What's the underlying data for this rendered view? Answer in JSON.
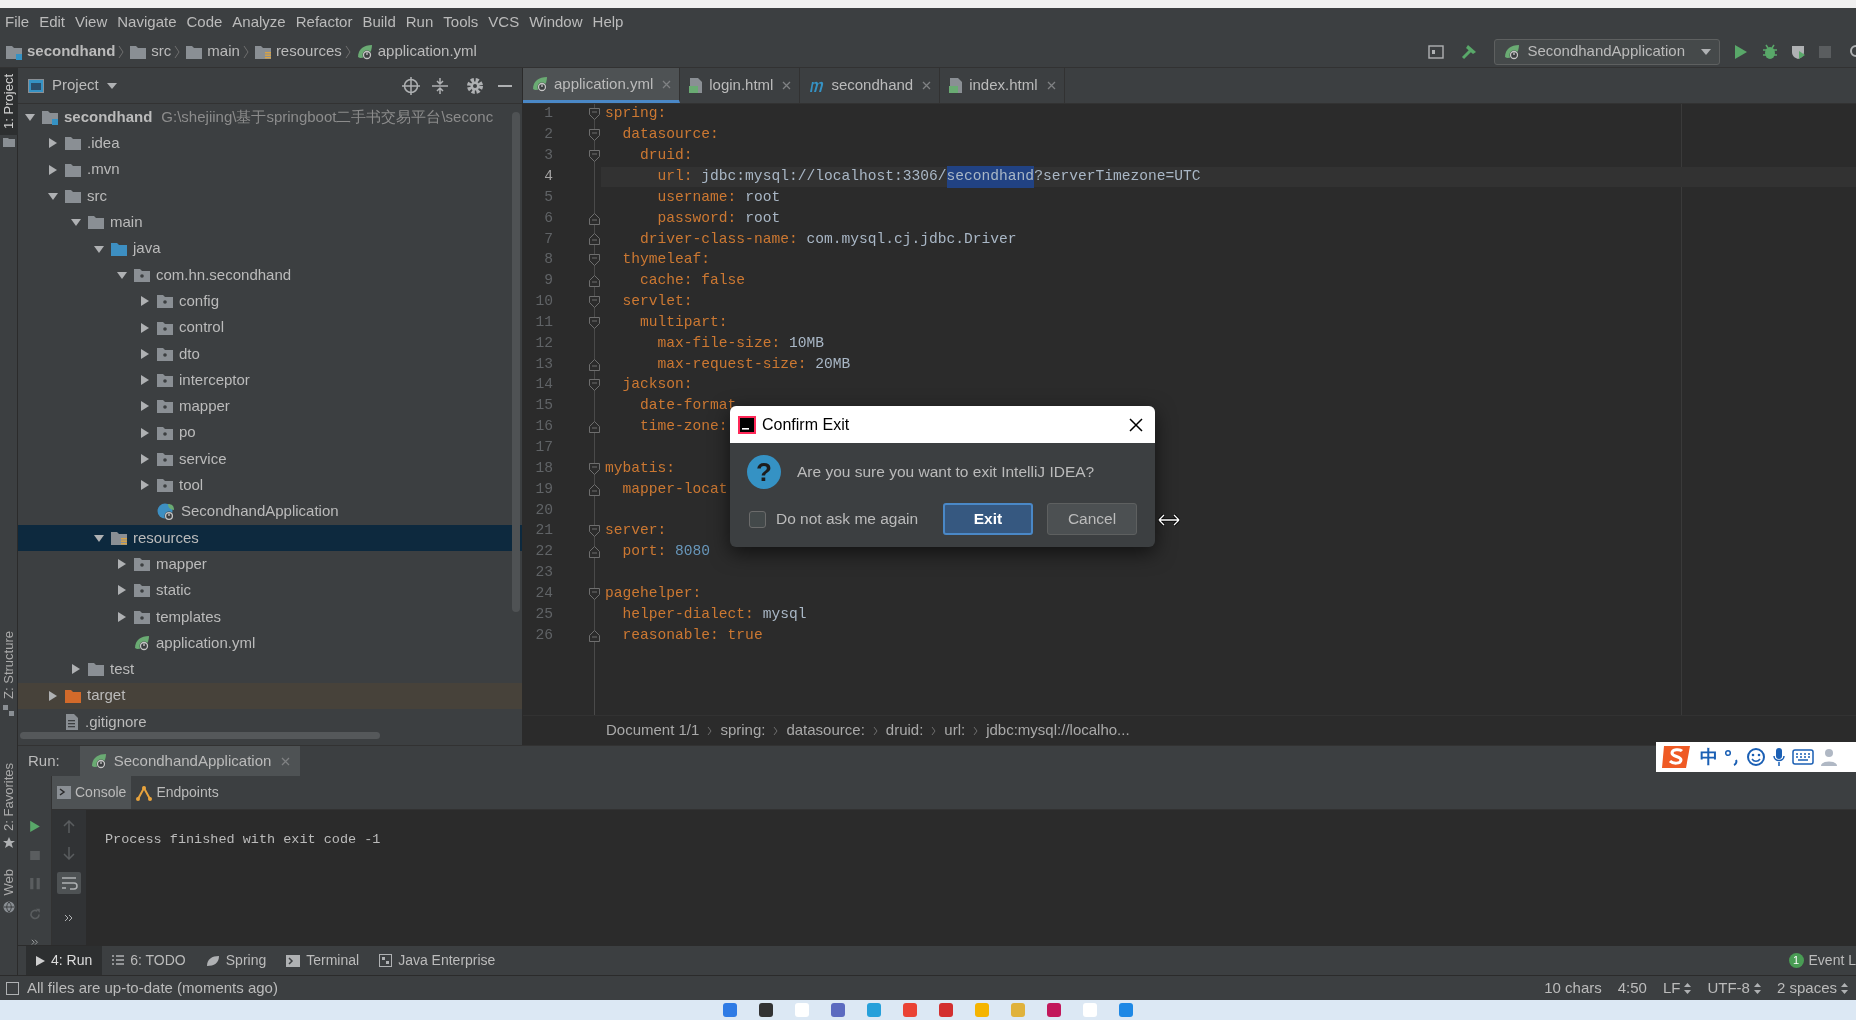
{
  "menu": [
    "File",
    "Edit",
    "View",
    "Navigate",
    "Code",
    "Analyze",
    "Refactor",
    "Build",
    "Run",
    "Tools",
    "VCS",
    "Window",
    "Help"
  ],
  "nav": {
    "crumbs": [
      {
        "label": "secondhand",
        "kind": "module"
      },
      {
        "label": "src",
        "kind": "folder"
      },
      {
        "label": "main",
        "kind": "folder"
      },
      {
        "label": "resources",
        "kind": "resources"
      },
      {
        "label": "application.yml",
        "kind": "yml"
      }
    ],
    "run_config": "SecondhandApplication"
  },
  "side_strip": {
    "top": [
      {
        "label": "1: Project",
        "selected": true
      }
    ],
    "middle": [
      {
        "label": "Z: Structure",
        "selected": false
      }
    ],
    "bottom": [
      {
        "label": "2: Favorites",
        "selected": false
      },
      {
        "label": "Web",
        "selected": false
      }
    ]
  },
  "project": {
    "title": "Project",
    "tree": [
      {
        "label": "secondhand",
        "path": "G:\\shejiing\\基于springboot二手书交易平台\\seconc",
        "kind": "module",
        "expanded": true,
        "selected": false,
        "children": [
          {
            "label": ".idea",
            "kind": "folder",
            "expanded": false,
            "selected": false
          },
          {
            "label": ".mvn",
            "kind": "folder",
            "expanded": false,
            "selected": false
          },
          {
            "label": "src",
            "kind": "folder",
            "expanded": true,
            "selected": false,
            "children": [
              {
                "label": "main",
                "kind": "folder",
                "expanded": true,
                "selected": false,
                "children": [
                  {
                    "label": "java",
                    "kind": "source",
                    "expanded": true,
                    "selected": false,
                    "children": [
                      {
                        "label": "com.hn.secondhand",
                        "kind": "package",
                        "expanded": true,
                        "selected": false,
                        "children": [
                          {
                            "label": "config",
                            "kind": "package",
                            "expanded": false,
                            "selected": false
                          },
                          {
                            "label": "control",
                            "kind": "package",
                            "expanded": false,
                            "selected": false
                          },
                          {
                            "label": "dto",
                            "kind": "package",
                            "expanded": false,
                            "selected": false
                          },
                          {
                            "label": "interceptor",
                            "kind": "package",
                            "expanded": false,
                            "selected": false
                          },
                          {
                            "label": "mapper",
                            "kind": "package",
                            "expanded": false,
                            "selected": false
                          },
                          {
                            "label": "po",
                            "kind": "package",
                            "expanded": false,
                            "selected": false
                          },
                          {
                            "label": "service",
                            "kind": "package",
                            "expanded": false,
                            "selected": false
                          },
                          {
                            "label": "tool",
                            "kind": "package",
                            "expanded": false,
                            "selected": false
                          },
                          {
                            "label": "SecondhandApplication",
                            "kind": "spring-class",
                            "selected": false
                          }
                        ]
                      }
                    ]
                  },
                  {
                    "label": "resources",
                    "kind": "resources",
                    "expanded": true,
                    "selected": true,
                    "children": [
                      {
                        "label": "mapper",
                        "kind": "package",
                        "expanded": false,
                        "selected": false
                      },
                      {
                        "label": "static",
                        "kind": "package",
                        "expanded": false,
                        "selected": false
                      },
                      {
                        "label": "templates",
                        "kind": "package",
                        "expanded": false,
                        "selected": false
                      },
                      {
                        "label": "application.yml",
                        "kind": "yml",
                        "selected": false
                      }
                    ]
                  }
                ]
              },
              {
                "label": "test",
                "kind": "folder",
                "expanded": false,
                "selected": false
              }
            ]
          },
          {
            "label": "target",
            "kind": "excluded",
            "expanded": false,
            "selected": false
          },
          {
            "label": ".gitignore",
            "kind": "file",
            "selected": false
          }
        ]
      }
    ]
  },
  "editor": {
    "tabs": [
      {
        "label": "application.yml",
        "kind": "yml",
        "selected": true
      },
      {
        "label": "login.html",
        "kind": "html",
        "selected": false
      },
      {
        "label": "secondhand",
        "kind": "maven",
        "selected": false
      },
      {
        "label": "index.html",
        "kind": "html",
        "selected": false
      }
    ],
    "lines": [
      {
        "n": "1",
        "key": "spring:",
        "fold_start": true,
        "children": [
          {
            "n": "2",
            "key": "datasource:",
            "fold_start": true,
            "children": [
              {
                "n": "3",
                "key": "druid:",
                "fold_start": true,
                "children": [
                  {
                    "n": "4",
                    "key": "url:",
                    "current": true,
                    "parts": [
                      {
                        "text": "jdbc:mysql://localhost:3306/",
                        "kind": "plain",
                        "selected": false
                      },
                      {
                        "text": "secondhand",
                        "kind": "plain",
                        "selected": true
                      },
                      {
                        "text": "?serverTimezone=UTC",
                        "kind": "plain",
                        "selected": false
                      }
                    ]
                  },
                  {
                    "n": "5",
                    "key": "username:",
                    "parts": [
                      {
                        "text": "root",
                        "kind": "plain"
                      }
                    ]
                  },
                  {
                    "n": "6",
                    "key": "password:",
                    "fold_end": true,
                    "parts": [
                      {
                        "text": "root",
                        "kind": "plain"
                      }
                    ]
                  }
                ]
              },
              {
                "n": "7",
                "key": "driver-class-name:",
                "fold_end": true,
                "parts": [
                  {
                    "text": "com.mysql.cj.jdbc.Driver",
                    "kind": "plain"
                  }
                ]
              }
            ]
          },
          {
            "n": "8",
            "key": "thymeleaf:",
            "fold_start": true,
            "children": [
              {
                "n": "9",
                "key": "cache:",
                "fold_end": true,
                "parts": [
                  {
                    "text": "false",
                    "kind": "keyword"
                  }
                ]
              }
            ]
          },
          {
            "n": "10",
            "key": "servlet:",
            "fold_start": true,
            "children": [
              {
                "n": "11",
                "key": "multipart:",
                "fold_start": true,
                "children": [
                  {
                    "n": "12",
                    "key": "max-file-size:",
                    "parts": [
                      {
                        "text": "10MB",
                        "kind": "plain"
                      }
                    ]
                  },
                  {
                    "n": "13",
                    "key": "max-request-size:",
                    "fold_end": true,
                    "parts": [
                      {
                        "text": "20MB",
                        "kind": "plain"
                      }
                    ]
                  }
                ]
              }
            ]
          },
          {
            "n": "14",
            "key": "jackson:",
            "fold_start": true,
            "children": [
              {
                "n": "15",
                "key": "date-format"
              },
              {
                "n": "16",
                "key": "time-zone:",
                "fold_end": true
              }
            ]
          }
        ]
      },
      {
        "n": "17"
      },
      {
        "n": "18",
        "key": "mybatis:",
        "fold_start": true,
        "children": [
          {
            "n": "19",
            "key": "mapper-locat",
            "fold_end": true
          }
        ]
      },
      {
        "n": "20"
      },
      {
        "n": "21",
        "key": "server:",
        "fold_start": true,
        "children": [
          {
            "n": "22",
            "key": "port:",
            "fold_end": true,
            "parts": [
              {
                "text": "8080",
                "kind": "number"
              }
            ]
          }
        ]
      },
      {
        "n": "23"
      },
      {
        "n": "24",
        "key": "pagehelper:",
        "fold_start": true,
        "children": [
          {
            "n": "25",
            "key": "helper-dialect:",
            "parts": [
              {
                "text": "mysql",
                "kind": "plain"
              }
            ]
          },
          {
            "n": "26",
            "key": "reasonable:",
            "fold_end": true,
            "parts": [
              {
                "text": "true",
                "kind": "keyword"
              }
            ]
          }
        ]
      }
    ],
    "breadcrumbs": [
      "Document 1/1",
      "spring:",
      "datasource:",
      "druid:",
      "url:",
      "jdbc:mysql://localho..."
    ]
  },
  "dialog": {
    "title": "Confirm Exit",
    "icon_text": "?",
    "message": "Are you sure you want to exit IntelliJ IDEA?",
    "checkbox": {
      "label": "Do not ask me again",
      "checked": false
    },
    "buttons": [
      {
        "label": "Exit",
        "kind": "default"
      },
      {
        "label": "Cancel",
        "kind": "normal"
      }
    ]
  },
  "run": {
    "label": "Run:",
    "tab": "SecondhandApplication",
    "subtabs": [
      {
        "label": "Console",
        "kind": "console",
        "selected": true
      },
      {
        "label": "Endpoints",
        "kind": "endpoints",
        "selected": false
      }
    ],
    "output": "Process finished with exit code -1",
    "ime_label": "中"
  },
  "tool_tabs": [
    {
      "label": "4: Run",
      "kind": "run",
      "selected": true
    },
    {
      "label": "6: TODO",
      "kind": "todo",
      "selected": false
    },
    {
      "label": "Spring",
      "kind": "spring",
      "selected": false
    },
    {
      "label": "Terminal",
      "kind": "terminal",
      "selected": false
    },
    {
      "label": "Java Enterprise",
      "kind": "enterprise",
      "selected": false
    }
  ],
  "event_log": {
    "count": "1",
    "label": "Event L"
  },
  "status": {
    "message": "All files are up-to-date (moments ago)",
    "items": [
      {
        "text": "10 chars",
        "kind": "text"
      },
      {
        "text": "4:50",
        "kind": "text"
      },
      {
        "text": "LF",
        "kind": "dropdown"
      },
      {
        "text": "UTF-8",
        "kind": "dropdown"
      },
      {
        "text": "2 spaces",
        "kind": "dropdown"
      }
    ]
  }
}
